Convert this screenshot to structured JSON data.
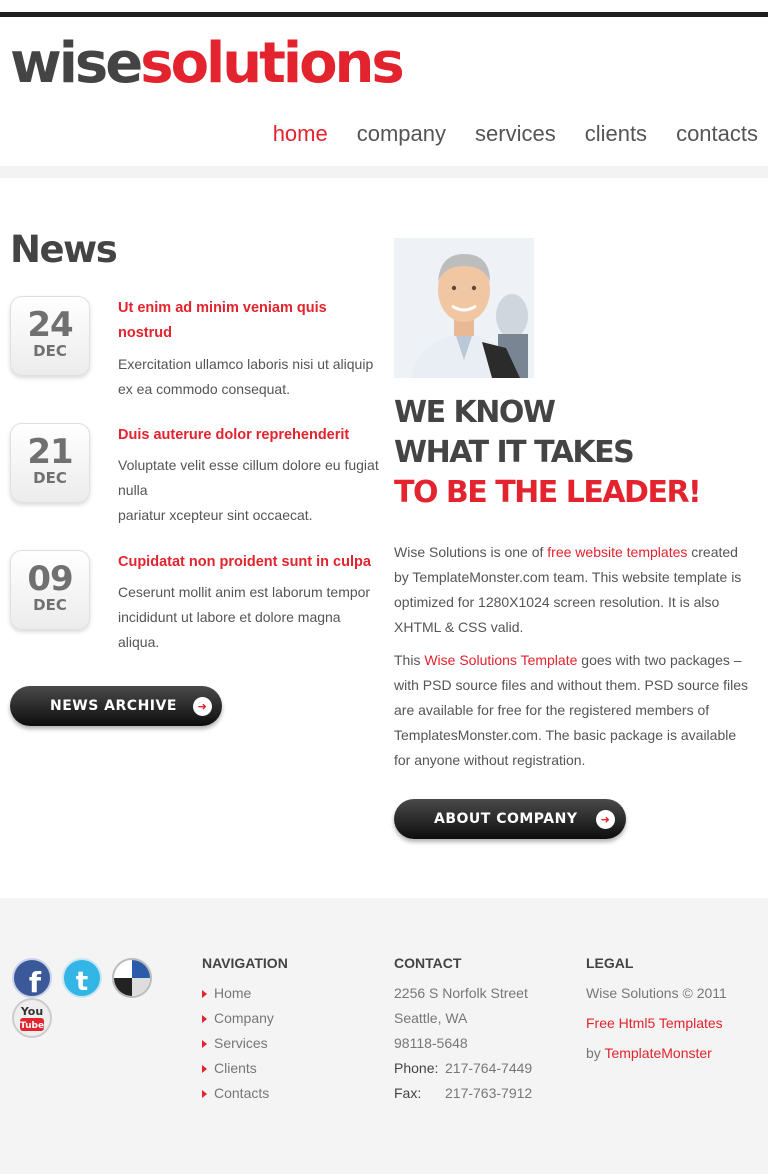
{
  "logo": {
    "part1": "wise",
    "part2": "solutions"
  },
  "nav": [
    {
      "label": "home",
      "active": true
    },
    {
      "label": "company",
      "active": false
    },
    {
      "label": "services",
      "active": false
    },
    {
      "label": "clients",
      "active": false
    },
    {
      "label": "contacts",
      "active": false
    }
  ],
  "news": {
    "title": "News",
    "items": [
      {
        "day": "24",
        "month": "DEC",
        "headline": "Ut enim ad minim veniam quis nostrud",
        "text": "Exercitation ullamco laboris nisi ut aliquip ex ea commodo consequat."
      },
      {
        "day": "21",
        "month": "DEC",
        "headline": "Duis auterure dolor reprehenderit",
        "text_lines": [
          "Voluptate velit esse cillum dolore eu fugiat nulla",
          "pariatur xcepteur sint occaecat."
        ]
      },
      {
        "day": "09",
        "month": "DEC",
        "headline": "Cupidatat non proident sunt in culpa",
        "text": "Ceserunt mollit anim est laborum tempor incididunt ut labore et dolore magna aliqua."
      }
    ],
    "archive_button": "NEWS ARCHIVE"
  },
  "about": {
    "slogan": [
      "WE KNOW",
      "WHAT IT TAKES",
      "TO BE THE LEADER!"
    ],
    "p1": {
      "before": "Wise Solutions is one of ",
      "link": "free website templates",
      "after": " created by TemplateMonster.com team. This website template is optimized for 1280X1024 screen resolution. It is also XHTML & CSS valid."
    },
    "p2": {
      "before": "This ",
      "link": "Wise Solutions Template",
      "after": " goes with two packages – with PSD source files and without them. PSD source files are available for free for the registered members of TemplatesMonster.com. The basic package is available for anyone without registration."
    },
    "button": "ABOUT COMPANY"
  },
  "footer": {
    "social": [
      "facebook-icon",
      "twitter-icon",
      "delicious-icon",
      "youtube-icon"
    ],
    "navigation": {
      "heading": "NAVIGATION",
      "items": [
        "Home",
        "Company",
        "Services",
        "Clients",
        "Contacts"
      ]
    },
    "contact": {
      "heading": "CONTACT",
      "street": "2256 S Norfolk Street",
      "city": "Seattle, WA",
      "zip": "98118-5648",
      "phone_label": "Phone:",
      "phone": "217-764-7449",
      "fax_label": "Fax:",
      "fax": "217-763-7912"
    },
    "legal": {
      "heading": "LEGAL",
      "copyright": "Wise Solutions © 2011",
      "link1": "Free Html5 Templates",
      "by": "by ",
      "link2": "TemplateMonster"
    }
  },
  "colors": {
    "accent": "#e3232d",
    "dark": "#444444",
    "footer_bg": "#f4f4f4"
  }
}
